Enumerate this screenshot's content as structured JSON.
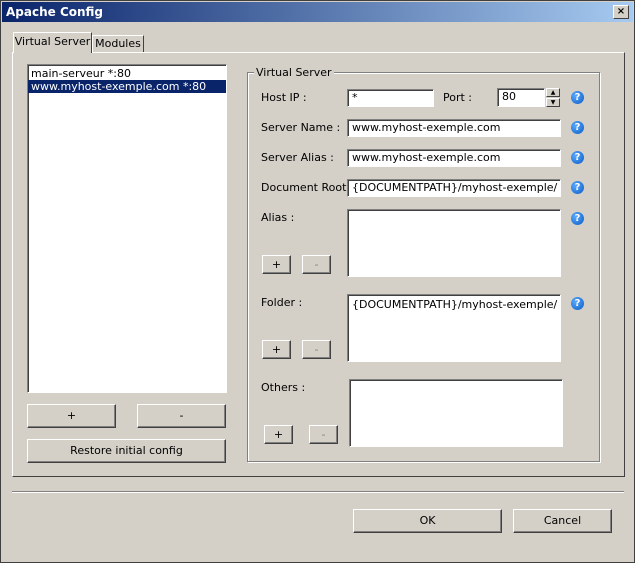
{
  "window": {
    "title": "Apache Config",
    "close_label": "×"
  },
  "tabs": [
    {
      "label": "Virtual Server",
      "active": true
    },
    {
      "label": "Modules",
      "active": false
    }
  ],
  "server_list": {
    "items": [
      "main-serveur *:80",
      "www.myhost-exemple.com *:80"
    ],
    "selected_index": 1
  },
  "left_buttons": {
    "add": "+",
    "remove": "-",
    "restore": "Restore initial config"
  },
  "group": {
    "title": "Virtual Server",
    "host_ip_label": "Host IP :",
    "host_ip_value": "*",
    "port_label": "Port :",
    "port_value": "80",
    "server_name_label": "Server Name :",
    "server_name_value": "www.myhost-exemple.com",
    "server_alias_label": "Server Alias :",
    "server_alias_value": "www.myhost-exemple.com",
    "document_root_label": "Document Root :",
    "document_root_value": "{DOCUMENTPATH}/myhost-exemple/",
    "alias_label": "Alias :",
    "alias_value": "",
    "folder_label": "Folder :",
    "folder_value": "{DOCUMENTPATH}/myhost-exemple/",
    "others_label": "Others :",
    "others_value": "",
    "plus": "+",
    "minus": "-",
    "help": "?"
  },
  "footer": {
    "ok": "OK",
    "cancel": "Cancel"
  }
}
